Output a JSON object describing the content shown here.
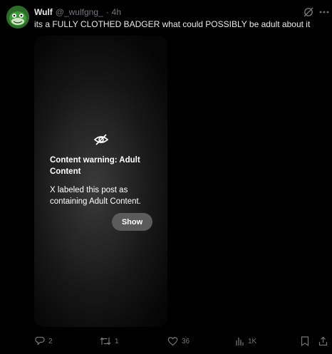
{
  "post": {
    "author": {
      "display_name": "Wulf",
      "handle": "@_wulfgng_",
      "separator": "·",
      "time": "4h"
    },
    "text": "its a FULLY CLOTHED BADGER what could POSSIBLY be adult about it",
    "media_warning": {
      "icon": "eye-slash-icon",
      "title": "Content warning: Adult Content",
      "body": "X labeled this post as containing Adult Content.",
      "show_label": "Show"
    },
    "actions": {
      "replies": "2",
      "reposts": "1",
      "likes": "36",
      "views": "1K"
    }
  },
  "colors": {
    "background": "#000000",
    "text_primary": "#e7e9ea",
    "text_secondary": "#71767b",
    "show_button": "#5b5b5b"
  }
}
